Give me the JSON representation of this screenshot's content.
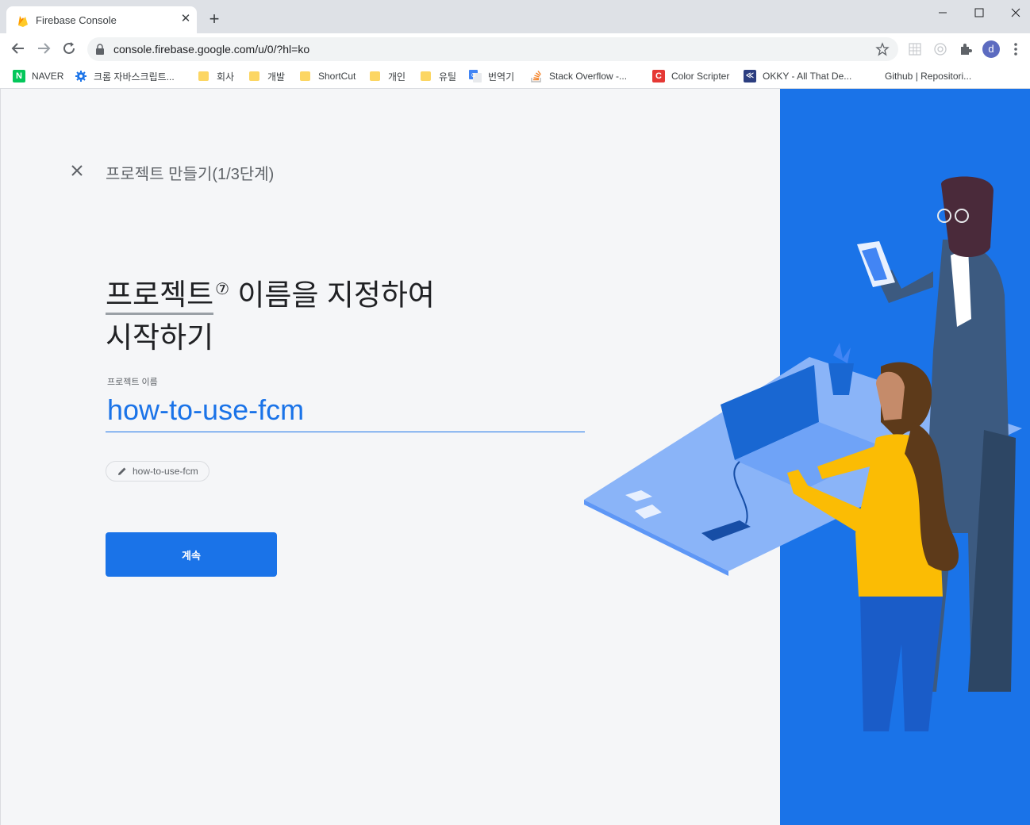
{
  "browser": {
    "tab": {
      "title": "Firebase Console"
    },
    "url": "console.firebase.google.com/u/0/?hl=ko",
    "profile_initial": "d",
    "bookmarks": [
      {
        "label": "NAVER",
        "icon": "naver-icon"
      },
      {
        "label": "크롬 자바스크립트...",
        "icon": "settings-icon"
      },
      {
        "label": "회사",
        "icon": "folder-icon"
      },
      {
        "label": "개발",
        "icon": "folder-icon"
      },
      {
        "label": "ShortCut",
        "icon": "folder-icon"
      },
      {
        "label": "개인",
        "icon": "folder-icon"
      },
      {
        "label": "유틸",
        "icon": "folder-icon"
      },
      {
        "label": "번역기",
        "icon": "google-translate-icon"
      },
      {
        "label": "Stack Overflow -...",
        "icon": "stackoverflow-icon"
      },
      {
        "label": "Color Scripter",
        "icon": "color-scripter-icon"
      },
      {
        "label": "OKKY - All That De...",
        "icon": "okky-icon"
      },
      {
        "label": "Github | Repositori...",
        "icon": "none"
      }
    ]
  },
  "page": {
    "step_title": "프로젝트 만들기(1/3단계)",
    "headline": {
      "term": "프로젝트",
      "line1_rest": " 이름을 지정하여",
      "line2": "시작하기"
    },
    "field_label": "프로젝트 이름",
    "project_name": "how-to-use-fcm",
    "project_id_chip": "how-to-use-fcm",
    "continue_label": "계속"
  },
  "colors": {
    "accent": "#1a73e8",
    "illustration_panel": "#1a73e8",
    "page_background": "#f5f6f8"
  }
}
